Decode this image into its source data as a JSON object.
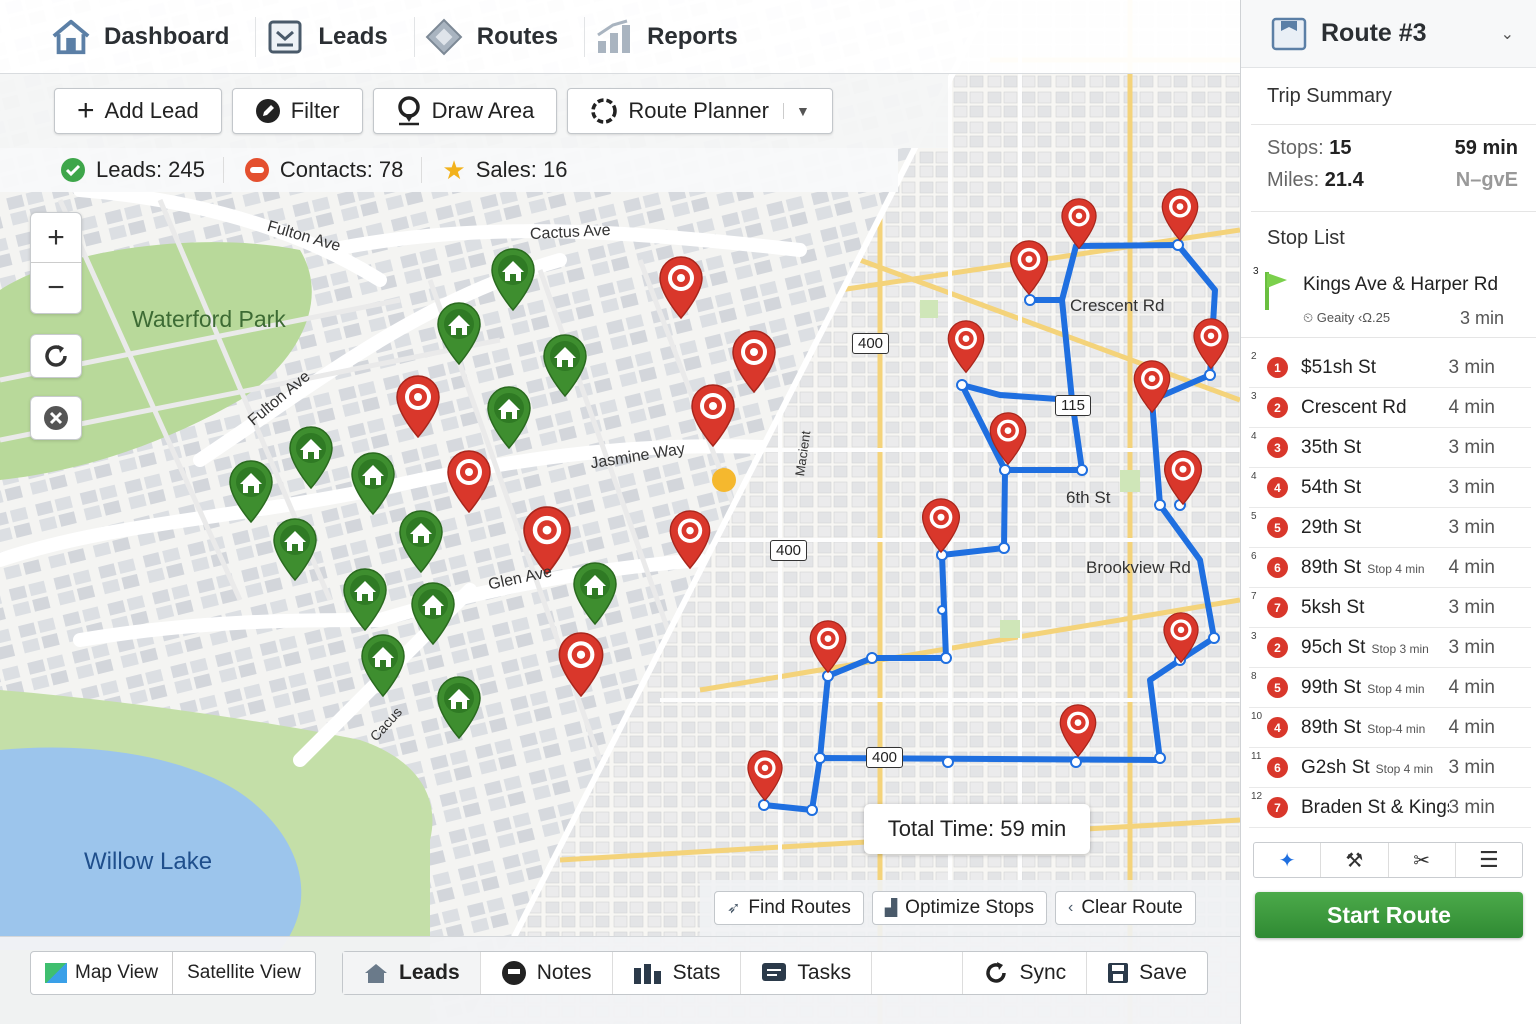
{
  "nav": {
    "items": [
      {
        "label": "Dashboard",
        "icon": "home-icon"
      },
      {
        "label": "Leads",
        "icon": "leads-icon"
      },
      {
        "label": "Routes",
        "icon": "routes-diamond-icon"
      },
      {
        "label": "Reports",
        "icon": "bar-chart-icon"
      }
    ]
  },
  "toolbar": {
    "add_lead": "Add Lead",
    "filter": "Filter",
    "draw_area": "Draw Area",
    "route_planner": "Route Planner"
  },
  "stats": {
    "leads": "Leads: 245",
    "contacts": "Contacts: 78",
    "sales": "Sales: 16"
  },
  "map": {
    "streets": {
      "fulton_ave_1": "Fulton Ave",
      "fulton_ave_2": "Fulton Ave",
      "cactus_ave": "Cactus Ave",
      "jasmine_way": "Jasmine Way",
      "glen_ave": "Glen Ave",
      "cacus": "Cacus",
      "crescent_rd": "Crescent Rd",
      "sixth_st": "6th St",
      "brookview_rd": "Brookview Rd",
      "macient": "Macient"
    },
    "park": "Waterford Park",
    "lake": "Willow Lake",
    "shields": {
      "s400a": "400",
      "s400b": "400",
      "s400c": "400",
      "s115": "115"
    },
    "total_time": "Total Time: 59 min"
  },
  "route_actions": {
    "find_routes": "Find Routes",
    "optimize_stops": "Optimize Stops",
    "clear_route": "Clear Route"
  },
  "bottom": {
    "map_view": "Map View",
    "satellite_view": "Satellite View",
    "tabs": {
      "leads": "Leads",
      "notes": "Notes",
      "stats": "Stats",
      "tasks": "Tasks",
      "sync": "Sync",
      "save": "Save"
    }
  },
  "panel": {
    "title": "Route #3",
    "trip_summary": "Trip Summary",
    "stops_label": "Stops:",
    "stops_value": "15",
    "time_value": "59 min",
    "miles_label": "Miles:",
    "miles_value": "21.4",
    "direction": "N–gvE",
    "stop_list_title": "Stop List",
    "featured": {
      "idx": "3",
      "name": "Kings Ave & Harper Rd",
      "sub": "Geaity ‹Ω.25",
      "time": "3 min"
    },
    "stops": [
      {
        "idx": "2",
        "num": "1",
        "name": "$51sh St",
        "sub": "",
        "time": "3 min"
      },
      {
        "idx": "3",
        "num": "2",
        "name": "Crescent Rd",
        "sub": "",
        "time": "4 min"
      },
      {
        "idx": "4",
        "num": "3",
        "name": "35th St",
        "sub": "",
        "time": "3 min"
      },
      {
        "idx": "4",
        "num": "4",
        "name": "54th St",
        "sub": "",
        "time": "3 min"
      },
      {
        "idx": "5",
        "num": "5",
        "name": "29th St",
        "sub": "",
        "time": "3 min"
      },
      {
        "idx": "6",
        "num": "6",
        "name": "89th St",
        "sub": "Stop 4 min",
        "time": "4 min"
      },
      {
        "idx": "7",
        "num": "7",
        "name": "5ksh St",
        "sub": "",
        "time": "3 min"
      },
      {
        "idx": "3",
        "num": "2",
        "name": "95ch St",
        "sub": "Stop 3 min",
        "time": "3 min"
      },
      {
        "idx": "8",
        "num": "5",
        "name": "99th St",
        "sub": "Stop 4 min",
        "time": "4 min"
      },
      {
        "idx": "10",
        "num": "4",
        "name": "89th St",
        "sub": "Stop-4 min",
        "time": "4 min"
      },
      {
        "idx": "11",
        "num": "6",
        "name": "G2sh St",
        "sub": "Stop 4 min",
        "time": "3 min"
      },
      {
        "idx": "12",
        "num": "7",
        "name": "Braden St & Kings...",
        "sub": "",
        "time": "3 min"
      }
    ],
    "start_route": "Start Route"
  },
  "colors": {
    "route_blue": "#1f6fe0",
    "lead_green": "#3e8e2f",
    "lead_red": "#d9372b",
    "start_green": "#3a9a3c"
  }
}
